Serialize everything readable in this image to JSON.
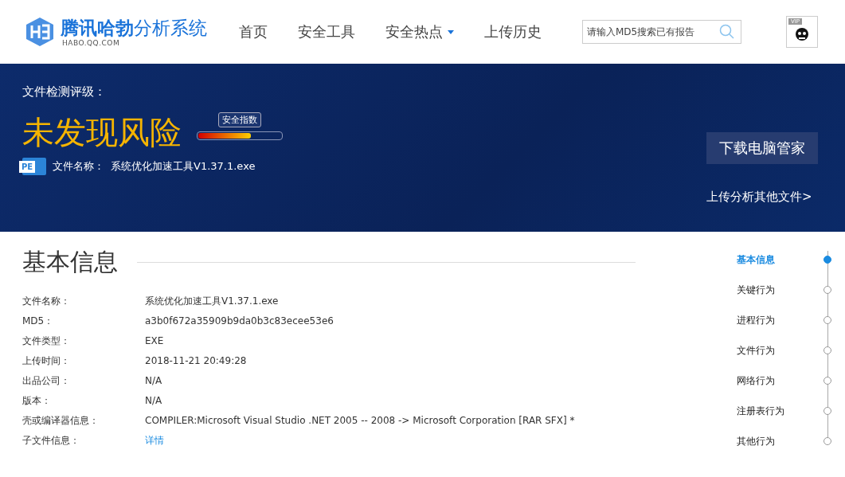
{
  "header": {
    "logo_title": "腾讯哈勃",
    "logo_subtitle": "分析系统",
    "logo_domain": "HABO.QQ.COM",
    "nav": [
      {
        "label": "首页",
        "dropdown": false
      },
      {
        "label": "安全工具",
        "dropdown": false
      },
      {
        "label": "安全热点",
        "dropdown": true
      },
      {
        "label": "上传历史",
        "dropdown": false
      }
    ],
    "search": {
      "placeholder": "请输入MD5搜索已有报告"
    },
    "vip_badge": "VIP"
  },
  "banner": {
    "rating_label": "文件检测评级：",
    "verdict": "未发现风险",
    "index_label": "安全指数",
    "index": {
      "level": 0.63
    },
    "file_type_badge": "PE",
    "file_name_label": "文件名称：",
    "file_name": "系统优化加速工具V1.37.1.exe",
    "download_button": "下载电脑管家",
    "upload_link": "上传分析其他文件>"
  },
  "basic_info": {
    "title": "基本信息",
    "rows": [
      {
        "label": "文件名称：",
        "value": "系统优化加速工具V1.37.1.exe",
        "kind": "text"
      },
      {
        "label": "MD5：",
        "value": "a3b0f672a35909b9da0b3c83ecee53e6",
        "kind": "text"
      },
      {
        "label": "文件类型：",
        "value": "EXE",
        "kind": "text"
      },
      {
        "label": "上传时间：",
        "value": "2018-11-21 20:49:28",
        "kind": "text"
      },
      {
        "label": "出品公司：",
        "value": "N/A",
        "kind": "text"
      },
      {
        "label": "版本：",
        "value": "N/A",
        "kind": "text"
      },
      {
        "label": "壳或编译器信息：",
        "value": "COMPILER:Microsoft Visual Studio .NET 2005 -- 2008 -> Microsoft Corporation [RAR SFX] *",
        "kind": "text"
      },
      {
        "label": "子文件信息：",
        "value": "详情",
        "kind": "link"
      }
    ]
  },
  "side_nav": [
    {
      "label": "基本信息",
      "selected": true
    },
    {
      "label": "关键行为",
      "selected": false
    },
    {
      "label": "进程行为",
      "selected": false
    },
    {
      "label": "文件行为",
      "selected": false
    },
    {
      "label": "网络行为",
      "selected": false
    },
    {
      "label": "注册表行为",
      "selected": false
    },
    {
      "label": "其他行为",
      "selected": false
    }
  ]
}
